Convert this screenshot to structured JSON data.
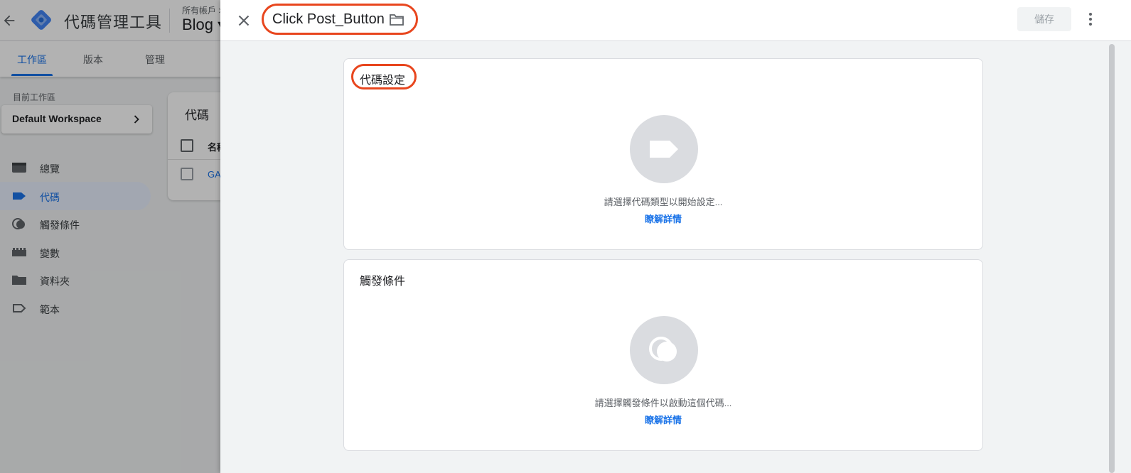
{
  "app": {
    "product_name": "代碼管理工具",
    "account_label": "所有帳戶 >",
    "container_name": "Blog ▾",
    "tabs": [
      {
        "label": "工作區",
        "active": true
      },
      {
        "label": "版本",
        "active": false
      },
      {
        "label": "管理",
        "active": false
      }
    ],
    "workspace_label": "目前工作區",
    "workspace_name": "Default Workspace",
    "nav": [
      {
        "label": "總覽",
        "icon": "overview-icon",
        "active": false
      },
      {
        "label": "代碼",
        "icon": "tag-icon",
        "active": true
      },
      {
        "label": "觸發條件",
        "icon": "trigger-icon",
        "active": false
      },
      {
        "label": "變數",
        "icon": "variables-icon",
        "active": false
      },
      {
        "label": "資料夾",
        "icon": "folder-icon",
        "active": false
      },
      {
        "label": "範本",
        "icon": "template-icon",
        "active": false
      }
    ],
    "tags_card": {
      "title": "代碼",
      "column_name": "名稱",
      "row_name": "GA"
    }
  },
  "editor": {
    "tag_title": "Click Post_Button",
    "save_label": "儲存",
    "config_card": {
      "title": "代碼設定",
      "hint": "請選擇代碼類型以開始設定...",
      "link": "瞭解詳情"
    },
    "trigger_card": {
      "title": "觸發條件",
      "hint": "請選擇觸發條件以啟動這個代碼...",
      "link": "瞭解詳情"
    }
  },
  "colors": {
    "accent": "#1a73e8",
    "highlight_ring": "#e8461e",
    "icon_circle": "#dadce0"
  }
}
